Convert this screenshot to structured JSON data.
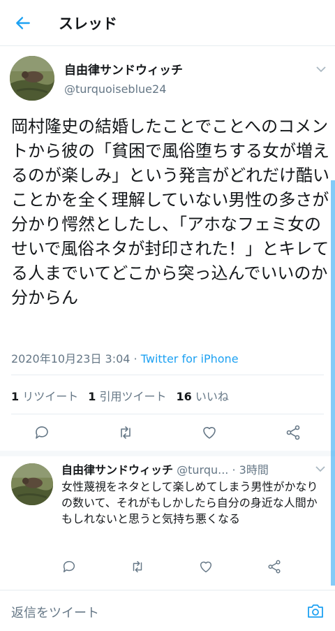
{
  "header": {
    "title": "スレッド",
    "back_icon": "back-arrow-icon"
  },
  "main_tweet": {
    "name": "自由律サンドウィッチ",
    "handle": "@turquoiseblue24",
    "text": "岡村隆史の結婚したことでことへのコメントから彼の「貧困で風俗堕ちする女が増えるのが楽しみ」という発言がどれだけ酷いことかを全く理解していない男性の多さが分かり愕然としたし、「アホなフェミ女のせいで風俗ネタが封印された！」とキレてる人までいてどこから突っ込んでいいのか分からん",
    "timestamp": "2020年10月23日 3:04",
    "separator": " · ",
    "source": "Twitter for iPhone",
    "stats": {
      "retweets_count": "1",
      "retweets_label": "リツイート",
      "quotes_count": "1",
      "quotes_label": "引用ツイート",
      "likes_count": "16",
      "likes_label": "いいね"
    },
    "actions": [
      "reply-icon",
      "retweet-icon",
      "like-icon",
      "share-icon"
    ]
  },
  "reply_tweet": {
    "name": "自由律サンドウィッチ",
    "handle": "@turqu...",
    "separator": " · ",
    "time": "3時間",
    "text": "女性蔑視をネタとして楽しめてしまう男性がかなりの数いて、それがもしかしたら自分の身近な人間かもしれないと思うと気持ち悪くなる"
  },
  "compose": {
    "placeholder": "返信をツイート",
    "camera_icon": "camera-icon"
  },
  "colors": {
    "accent": "#1da1f2",
    "secondary_text": "#657786",
    "divider": "#e6ecf0"
  }
}
